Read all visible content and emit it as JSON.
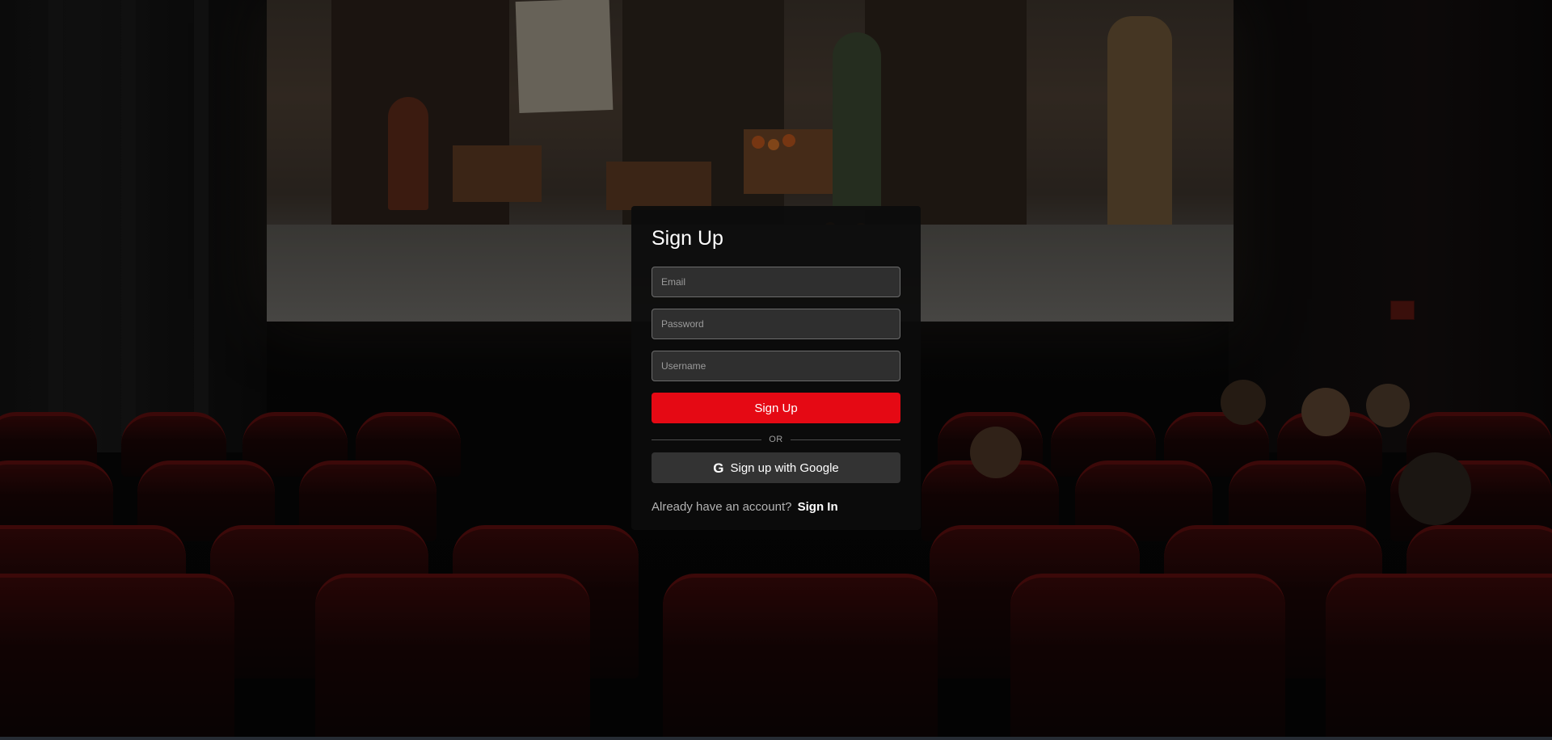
{
  "form": {
    "title": "Sign Up",
    "email_placeholder": "Email",
    "password_placeholder": "Password",
    "username_placeholder": "Username",
    "submit_label": "Sign Up",
    "divider_text": "OR",
    "google_label": "Sign up with Google",
    "google_icon": "G",
    "signin_prompt": "Already have an account?",
    "signin_link": "Sign In"
  },
  "colors": {
    "accent": "#e50914",
    "card_bg": "#0c0c0c",
    "input_bg": "#2f2f2f",
    "google_button_bg": "#333333"
  }
}
